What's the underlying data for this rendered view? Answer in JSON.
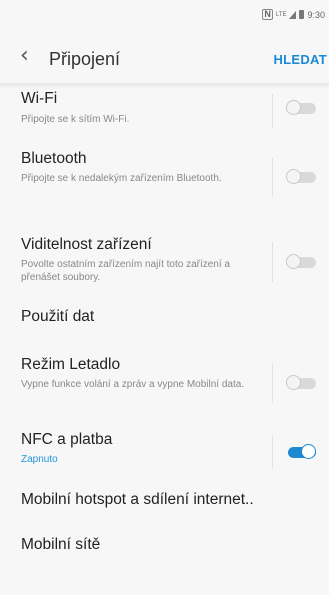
{
  "status_bar": {
    "nfc_label": "N",
    "network_label": "LTE",
    "time": "9:30",
    "icons": [
      "nfc-icon",
      "lte-icon",
      "signal-icon",
      "battery-icon"
    ]
  },
  "header": {
    "back_icon": "chevron-left-icon",
    "title": "Připojení",
    "search_label": "HLEDAT"
  },
  "settings": {
    "wifi": {
      "title": "Wi-Fi",
      "subtitle": "Připojte se k sítím Wi-Fi.",
      "toggle_on": false
    },
    "bluetooth": {
      "title": "Bluetooth",
      "subtitle": "Připojte se k nedalekým zařízením Bluetooth.",
      "toggle_on": false
    },
    "visibility": {
      "title": "Viditelnost zařízení",
      "subtitle": "Povolte ostatním zařízením najít toto zařízení a přenášet soubory.",
      "toggle_on": false
    },
    "data_usage": {
      "title": "Použití dat"
    },
    "airplane": {
      "title": "Režim Letadlo",
      "subtitle": "Vypne funkce volání a zpráv a vypne Mobilní data.",
      "toggle_on": false
    },
    "nfc": {
      "title": "NFC a platba",
      "subtitle": "Zapnuto",
      "toggle_on": true
    },
    "hotspot": {
      "title": "Mobilní hotspot a sdílení internet.."
    },
    "mobile_networks": {
      "title": "Mobilní sítě"
    }
  },
  "colors": {
    "accent": "#1b8ad4",
    "background": "#f7f7f7",
    "toggle_on": "#1e88d1",
    "toggle_off": "#d9d9d9"
  }
}
